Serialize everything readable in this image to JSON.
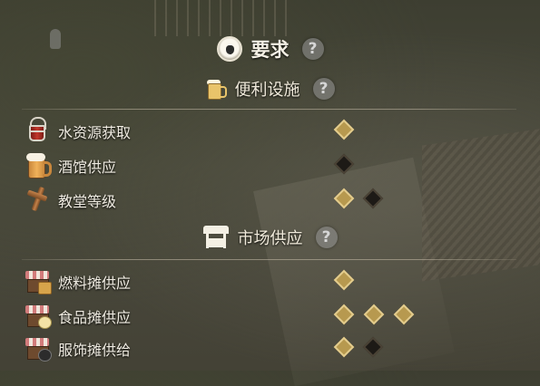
{
  "header": {
    "title": "要求",
    "help": "?"
  },
  "sections": [
    {
      "title": "便利设施",
      "help": "?",
      "items": [
        {
          "label": "水资源获取",
          "icon": "water-bucket-icon",
          "requirements": [
            "met"
          ]
        },
        {
          "label": "酒馆供应",
          "icon": "beer-mug-icon",
          "requirements": [
            "unmet"
          ]
        },
        {
          "label": "教堂等级",
          "icon": "church-cross-icon",
          "requirements": [
            "met",
            "unmet"
          ]
        }
      ]
    },
    {
      "title": "市场供应",
      "help": "?",
      "items": [
        {
          "label": "燃料摊供应",
          "icon": "fuel-stall-icon",
          "requirements": [
            "met"
          ]
        },
        {
          "label": "食品摊供应",
          "icon": "food-stall-icon",
          "requirements": [
            "met",
            "met",
            "met"
          ]
        },
        {
          "label": "服饰摊供给",
          "icon": "clothing-stall-icon",
          "requirements": [
            "met",
            "unmet"
          ]
        }
      ]
    }
  ],
  "colors": {
    "met": "#b7994f",
    "unmet": "#1d1a16",
    "text": "#f0ece2"
  }
}
